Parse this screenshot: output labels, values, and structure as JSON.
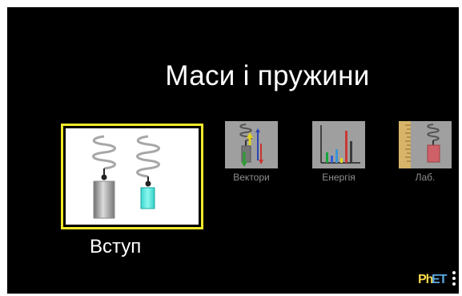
{
  "home": {
    "title": "Маси і пружини",
    "screens": [
      {
        "label": "Вступ",
        "selected": true,
        "icon": "intro-springs-icon"
      },
      {
        "label": "Вектори",
        "selected": false,
        "icon": "vectors-thumbnail-icon"
      },
      {
        "label": "Енергія",
        "selected": false,
        "icon": "energy-thumbnail-icon"
      },
      {
        "label": "Лаб.",
        "selected": false,
        "icon": "lab-thumbnail-icon"
      }
    ]
  },
  "branding": {
    "logo": "PhET",
    "logo_parts": [
      "Ph",
      "ET"
    ],
    "menu_icon": "vertical-dots-icon"
  },
  "colors": {
    "background": "#000000",
    "selection_border": "#f2ea2a",
    "title_text": "#ffffff",
    "inactive_label": "#8f8f8f",
    "logo_yellow": "#f6d64b",
    "logo_blue": "#5aa9df"
  }
}
